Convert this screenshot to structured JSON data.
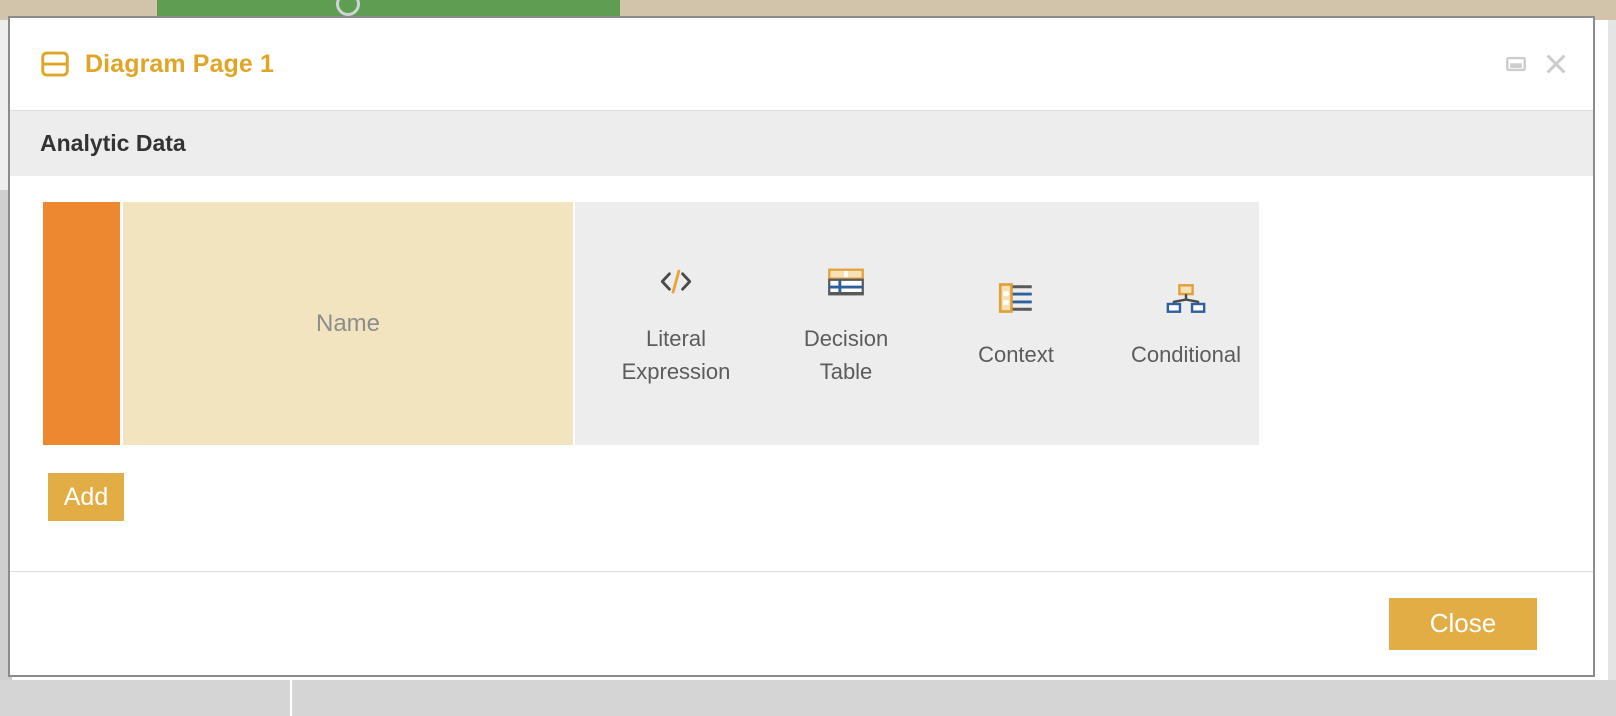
{
  "background": {
    "topbar_color": "#d2c4ab",
    "progress_color": "#5f9e52",
    "spinner_icon": "loading-spinner-icon"
  },
  "modal": {
    "title": "Diagram Page 1",
    "title_color": "#e0a526",
    "title_icon": "diagram-page-icon",
    "controls": [
      {
        "name": "restore-window-button",
        "icon": "restore-window-icon",
        "label": "Restore"
      },
      {
        "name": "close-window-button",
        "icon": "close-x-icon",
        "label": "Close"
      }
    ],
    "section": {
      "title": "Analytic Data"
    },
    "entry": {
      "accent_color": "#ee8830",
      "name_placeholder": "Name",
      "name_value": "",
      "name_field_color": "#f2e4bf",
      "types": [
        {
          "id": "literal-expression",
          "label": "Literal\nExpression",
          "label_line1": "Literal",
          "label_line2": "Expression",
          "icon": "code-brackets-icon"
        },
        {
          "id": "decision-table",
          "label": "Decision\nTable",
          "label_line1": "Decision",
          "label_line2": "Table",
          "icon": "decision-table-icon"
        },
        {
          "id": "context",
          "label": "Context",
          "label_line1": "Context",
          "label_line2": "",
          "icon": "context-list-icon"
        },
        {
          "id": "conditional",
          "label": "Conditional",
          "label_line1": "Conditional",
          "label_line2": "",
          "icon": "conditional-tree-icon"
        }
      ]
    },
    "add_label": "Add",
    "footer": {
      "close_label": "Close"
    },
    "button_color": "#e2ad44"
  }
}
